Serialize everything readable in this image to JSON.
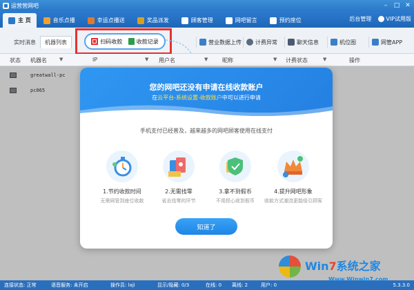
{
  "window": {
    "title": "运营营网吧"
  },
  "nav": {
    "tabs": [
      {
        "label": "主  页",
        "color": "#2a78c8"
      },
      {
        "label": "音乐点播",
        "color": "#f0a030"
      },
      {
        "label": "幸运点播送",
        "color": "#e07a2a"
      },
      {
        "label": "奖品派发",
        "color": "#d9a020"
      },
      {
        "label": "顾客管理",
        "color": "#3a8ad8"
      },
      {
        "label": "网吧留言",
        "color": "#3a8ad8"
      },
      {
        "label": "预约座位",
        "color": "#3a8ad8"
      }
    ],
    "right": {
      "admin": "后台管理",
      "vip": "VIP试用版"
    }
  },
  "toolbar": {
    "subtabs": [
      "实时消息",
      "机器列表"
    ],
    "scan_collect": "扫码收款",
    "collect_records": "收款记录",
    "buttons": [
      "营业数据上传",
      "计费异常",
      "聊天信息",
      "机位图",
      "网管APP"
    ]
  },
  "table": {
    "headers": [
      "状态",
      "机器名",
      "IP",
      "用户名",
      "昵称",
      "计费状态",
      "操作"
    ],
    "rows": [
      {
        "name": "greatwall-pc"
      },
      {
        "name": "pc065"
      }
    ]
  },
  "modal": {
    "title": "您的网吧还没有申请在线收款账户",
    "sub_prefix": "在",
    "sub_highlight": "云平台-系统设置-收款账户",
    "sub_suffix": "中可以进行申请",
    "desc": "手机支付已经普及，越来越多的网吧顾客使用在线支付",
    "features": [
      {
        "name": "1.节约收款时间",
        "desc": "无需网管到座位收款"
      },
      {
        "name": "2.无需找零",
        "desc": "省去找零的环节"
      },
      {
        "name": "3.拿不到假币",
        "desc": "不用担心收到假币"
      },
      {
        "name": "4.提升网吧形象",
        "desc": "收款方式潮流更能吸引顾客"
      }
    ],
    "ok_label": "知道了"
  },
  "status": {
    "conn": "连接状态: 正常",
    "voice": "语音服务: 未开启",
    "operator": "操作员: laji",
    "display": "显示/隐藏: 0/3",
    "online": "在线: 0",
    "offline": "离线: 2",
    "users": "用户: 0",
    "version": "5.3.3.0"
  },
  "watermark": {
    "text_a": "Win",
    "text_b": "7",
    "text_c": "系统之家",
    "url": "Www.Winwin7.com"
  }
}
